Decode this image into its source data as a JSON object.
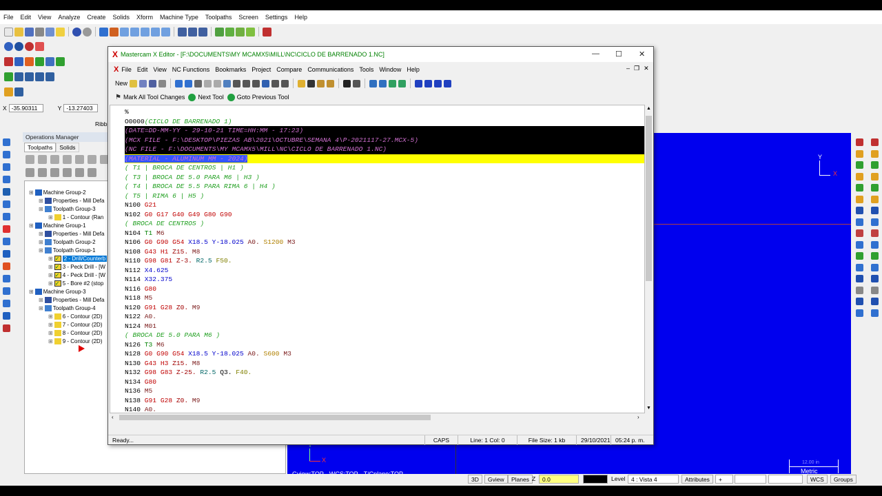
{
  "main_menu": [
    "File",
    "Edit",
    "View",
    "Analyze",
    "Create",
    "Solids",
    "Xform",
    "Machine Type",
    "Toolpaths",
    "Screen",
    "Settings",
    "Help"
  ],
  "coords": {
    "x_label": "X",
    "x_value": "-35.90311",
    "y_label": "Y",
    "y_value": "-13.27403",
    "ribbon": "Ribb"
  },
  "ops_manager": {
    "title": "Operations Manager",
    "tabs": [
      "Toolpaths",
      "Solids"
    ],
    "tree": [
      {
        "text": "Machine Group-2",
        "indent": 0,
        "icon": "machine"
      },
      {
        "text": "Properties - Mill Defa",
        "indent": 1,
        "icon": "props"
      },
      {
        "text": "Toolpath Group-3",
        "indent": 1,
        "icon": "group"
      },
      {
        "text": "1 - Contour (Ran",
        "indent": 2,
        "icon": "folder"
      },
      {
        "text": "Machine Group-1",
        "indent": 0,
        "icon": "machine"
      },
      {
        "text": "Properties - Mill Defa",
        "indent": 1,
        "icon": "props"
      },
      {
        "text": "Toolpath Group-2",
        "indent": 1,
        "icon": "group"
      },
      {
        "text": "Toolpath Group-1",
        "indent": 1,
        "icon": "group"
      },
      {
        "text": "2 - Drill/Counterb",
        "indent": 2,
        "icon": "check",
        "selected": true
      },
      {
        "text": "3 - Peck Drill - [W",
        "indent": 2,
        "icon": "check"
      },
      {
        "text": "4 - Peck Drill - [W",
        "indent": 2,
        "icon": "check"
      },
      {
        "text": "5 - Bore #2 (stop",
        "indent": 2,
        "icon": "check"
      },
      {
        "text": "Machine Group-3",
        "indent": 0,
        "icon": "machine"
      },
      {
        "text": "Properties - Mill Defa",
        "indent": 1,
        "icon": "props"
      },
      {
        "text": "Toolpath Group-4",
        "indent": 1,
        "icon": "group"
      },
      {
        "text": "6 - Contour (2D)",
        "indent": 2,
        "icon": "folder"
      },
      {
        "text": "7 - Contour (2D)",
        "indent": 2,
        "icon": "folder"
      },
      {
        "text": "8 - Contour (2D)",
        "indent": 2,
        "icon": "folder"
      },
      {
        "text": "9 - Contour (2D)",
        "indent": 2,
        "icon": "folder"
      }
    ]
  },
  "viewport": {
    "axis_y": "Y",
    "axis_x": "X",
    "gview": "Gview:TOP",
    "wcs": "WCS:TOP",
    "tplane": "T/Cplane:TOP",
    "scale_value": "12.00 in",
    "units": "Metric"
  },
  "editor": {
    "title": "Mastercam X Editor - [F:\\DOCUMENTS\\MY MCAMX5\\MILL\\NC\\CICLO DE BARRENADO 1.NC]",
    "menu": [
      "File",
      "Edit",
      "View",
      "NC Functions",
      "Bookmarks",
      "Project",
      "Compare",
      "Communications",
      "Tools",
      "Window",
      "Help"
    ],
    "toolbar_new": "New",
    "tool_buttons": [
      "Mark All Tool Changes",
      "Next Tool",
      "Goto Previous Tool"
    ],
    "status": {
      "ready": "Ready...",
      "caps": "CAPS",
      "line_col": "Line:  1  Col:  0",
      "file_size": "File Size: 1 kb",
      "date": "29/10/2021",
      "time": "05:24 p. m."
    }
  },
  "code_lines": [
    [
      [
        "%",
        ""
      ]
    ],
    [
      [
        "O0000",
        ""
      ],
      [
        "(CICLO DE BARRENADO 1)",
        "cm"
      ]
    ],
    [
      [
        "(DATE=DD-MM-YY - 29-10-21 TIME=HH:MM - 17:23)",
        "cmw"
      ]
    ],
    [
      [
        "(MCX FILE - F:\\DESKTOP\\PIEZAS AB\\2021\\OCTUBRE\\SEMANA 4\\P-2021117-27.MCX-5)",
        "cmw"
      ]
    ],
    [
      [
        "(NC FILE - F:\\DOCUMENTS\\MY MCAMX5\\MILL\\NC\\CICLO DE BARRENADO 1.NC)",
        "cmw"
      ]
    ],
    [
      [
        "(MATERIAL - ALUMINUM MM - 2024)",
        "cmw"
      ]
    ],
    [
      [
        "( T1 | BROCA DE CENTROS | H1 )",
        "cm"
      ]
    ],
    [
      [
        "( T3 | BROCA DE 5.0 PARA M6 | H3 )",
        "cm"
      ]
    ],
    [
      [
        "( T4 | BROCA DE 5.5 PARA RIMA 6 | H4 )",
        "cm"
      ]
    ],
    [
      [
        "( T5 | RIMA 6 | H5 )",
        "cm"
      ]
    ],
    [
      [
        "N100 ",
        ""
      ],
      [
        "G21",
        "g"
      ]
    ],
    [
      [
        "N102 ",
        ""
      ],
      [
        "G0 G17 G40 G49 G80 G90",
        "g"
      ]
    ],
    [
      [
        "( BROCA DE CENTROS )",
        "cm"
      ]
    ],
    [
      [
        "N104 ",
        ""
      ],
      [
        "T1",
        "t"
      ],
      [
        " ",
        ""
      ],
      [
        "M6",
        "m"
      ]
    ],
    [
      [
        "N106 ",
        ""
      ],
      [
        "G0 G90 G54 ",
        "g"
      ],
      [
        "X18.5 Y-18.025 ",
        "xy"
      ],
      [
        "A0. ",
        "m"
      ],
      [
        "S1200 ",
        "s"
      ],
      [
        "M3",
        "m"
      ]
    ],
    [
      [
        "N108 ",
        ""
      ],
      [
        "G43 H1 ",
        "g"
      ],
      [
        "Z15. ",
        "z"
      ],
      [
        "M8",
        "m"
      ]
    ],
    [
      [
        "N110 ",
        ""
      ],
      [
        "G98 G81 ",
        "g"
      ],
      [
        "Z-3. ",
        "z"
      ],
      [
        "R2.5 ",
        "ax"
      ],
      [
        "F50.",
        "f"
      ]
    ],
    [
      [
        "N112 ",
        ""
      ],
      [
        "X4.625",
        "xy"
      ]
    ],
    [
      [
        "N114 ",
        ""
      ],
      [
        "X32.375",
        "xy"
      ]
    ],
    [
      [
        "N116 ",
        ""
      ],
      [
        "G80",
        "g"
      ]
    ],
    [
      [
        "N118 ",
        ""
      ],
      [
        "M5",
        "m"
      ]
    ],
    [
      [
        "N120 ",
        ""
      ],
      [
        "G91 G28 ",
        "g"
      ],
      [
        "Z0. ",
        "z"
      ],
      [
        "M9",
        "m"
      ]
    ],
    [
      [
        "N122 ",
        ""
      ],
      [
        "A0.",
        "m"
      ]
    ],
    [
      [
        "N124 ",
        ""
      ],
      [
        "M01",
        "m"
      ]
    ],
    [
      [
        "( BROCA DE 5.0 PARA M6 )",
        "cm"
      ]
    ],
    [
      [
        "N126 ",
        ""
      ],
      [
        "T3",
        "t"
      ],
      [
        " ",
        ""
      ],
      [
        "M6",
        "m"
      ]
    ],
    [
      [
        "N128 ",
        ""
      ],
      [
        "G0 G90 G54 ",
        "g"
      ],
      [
        "X18.5 Y-18.025 ",
        "xy"
      ],
      [
        "A0. ",
        "m"
      ],
      [
        "S600 ",
        "s"
      ],
      [
        "M3",
        "m"
      ]
    ],
    [
      [
        "N130 ",
        ""
      ],
      [
        "G43 H3 ",
        "g"
      ],
      [
        "Z15. ",
        "z"
      ],
      [
        "M8",
        "m"
      ]
    ],
    [
      [
        "N132 ",
        ""
      ],
      [
        "G98 G83 ",
        "g"
      ],
      [
        "Z-25. ",
        "z"
      ],
      [
        "R2.5 ",
        "ax"
      ],
      [
        "Q3. ",
        ""
      ],
      [
        "F40.",
        "f"
      ]
    ],
    [
      [
        "N134 ",
        ""
      ],
      [
        "G80",
        "g"
      ]
    ],
    [
      [
        "N136 ",
        ""
      ],
      [
        "M5",
        "m"
      ]
    ],
    [
      [
        "N138 ",
        ""
      ],
      [
        "G91 G28 ",
        "g"
      ],
      [
        "Z0. ",
        "z"
      ],
      [
        "M9",
        "m"
      ]
    ],
    [
      [
        "N140 ",
        ""
      ],
      [
        "A0.",
        "m"
      ]
    ]
  ],
  "bottom_bar": {
    "b3d": "3D",
    "gview": "Gview",
    "planes": "Planes",
    "z": "Z",
    "z_value": "0.0",
    "level_label": "Level",
    "level_value": "4 : Vista 4",
    "attributes": "Attributes",
    "wcs": "WCS",
    "groups": "Groups"
  }
}
